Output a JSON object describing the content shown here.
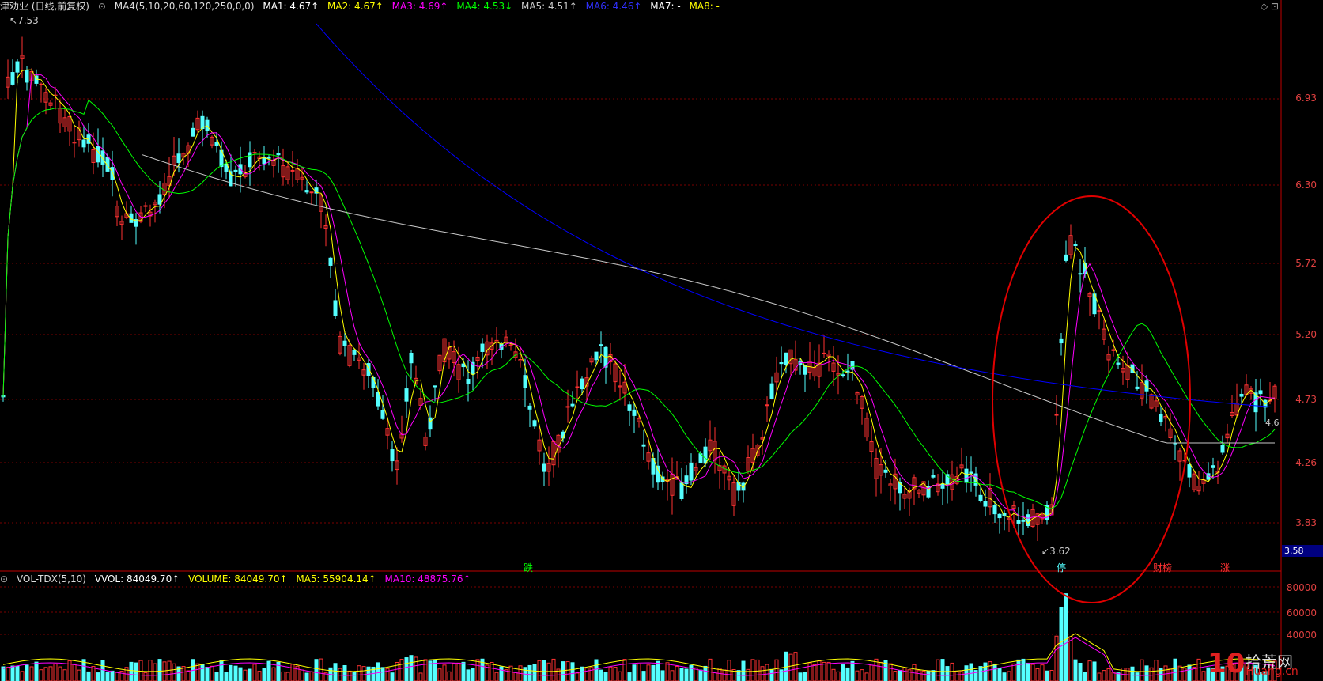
{
  "header": {
    "stock_name": "津劝业 (日线,前复权)",
    "indicator": "MA4(5,10,20,60,120,250,0,0)",
    "ma1": "MA1: 4.67↑",
    "ma2": "MA2: 4.67↑",
    "ma3": "MA3: 4.69↑",
    "ma4": "MA4: 4.53↓",
    "ma5": "MA5: 4.51↑",
    "ma6": "MA6: 4.46↑",
    "ma7": "MA7: -",
    "ma8": "MA8: -"
  },
  "volume_header": {
    "indicator": "VOL-TDX(5,10)",
    "vvol": "VVOL: 84049.70↑",
    "volume": "VOLUME: 84049.70↑",
    "ma5": "MA5: 55904.14↑",
    "ma10": "MA10: 48875.76↑"
  },
  "price_axis": [
    "6.93",
    "6.30",
    "5.72",
    "5.20",
    "4.73",
    "4.26",
    "3.83"
  ],
  "volume_axis": [
    "80000",
    "60000",
    "40000"
  ],
  "current_price_tag": "3.58",
  "annotations": {
    "high": "7.53",
    "low": "3.62",
    "right_value": "4.6"
  },
  "markers": [
    "跌",
    "停",
    "财榜",
    "涨"
  ],
  "logo_text": "拾荒网",
  "logo_sub": "Huang.cn",
  "colors": {
    "up": "#ff3232",
    "down": "#54ffff",
    "ma1": "#ffffff",
    "ma2": "#ffff00",
    "ma3": "#ff00ff",
    "ma4": "#00ff00",
    "ma5": "#c8c8c8",
    "ma6": "#0000ff",
    "circle": "#e00000"
  },
  "chart_data": {
    "type": "candlestick",
    "price_ticks": [
      6.93,
      6.3,
      5.72,
      5.2,
      4.73,
      4.26,
      3.83
    ],
    "high": 7.53,
    "low": 3.62,
    "last_close": 4.67,
    "volume_ticks": [
      80000,
      60000,
      40000
    ],
    "last_volume": 84049.7
  }
}
